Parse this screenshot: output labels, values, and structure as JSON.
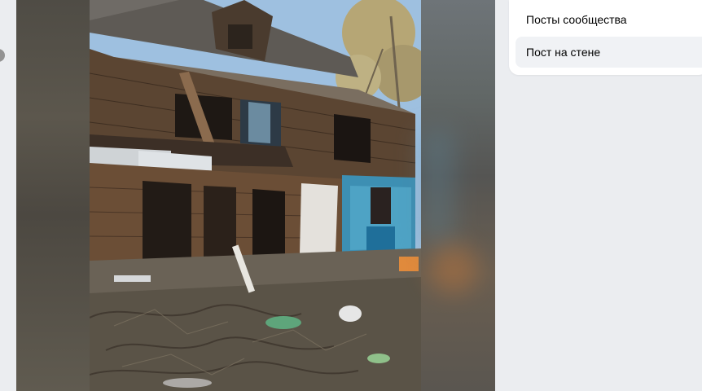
{
  "menu": {
    "items": [
      {
        "label": "Посты сообщества",
        "selected": false
      },
      {
        "label": "Пост на стене",
        "selected": true
      }
    ]
  },
  "viewer": {
    "photo_subject": "abandoned burnt wooden two-storey house"
  },
  "colors": {
    "page_background": "#ebedf0",
    "menu_background": "#ffffff",
    "menu_selected_background": "#f0f2f5"
  }
}
